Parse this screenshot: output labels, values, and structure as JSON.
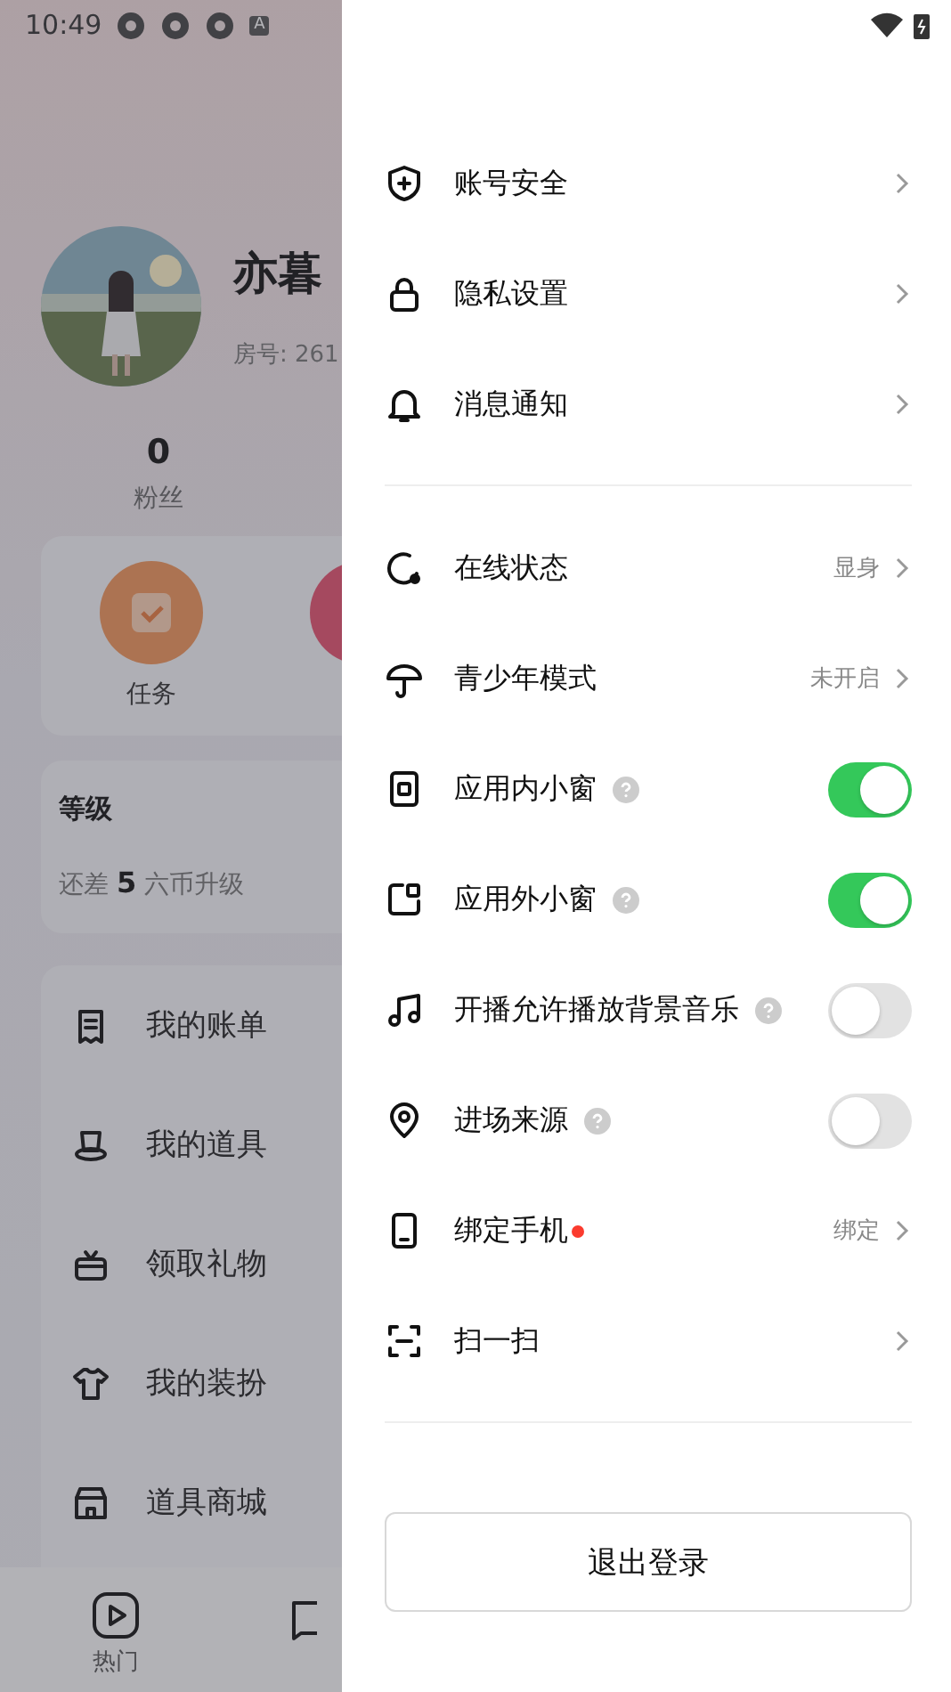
{
  "background_page": {
    "status_bar": {
      "time": "10:49",
      "badge": "A"
    },
    "profile": {
      "name": "亦暮",
      "room": "房号: 261"
    },
    "stats": [
      {
        "value": "0",
        "label": "粉丝"
      }
    ],
    "shortcuts": [
      {
        "label": "任务"
      }
    ],
    "level_card": {
      "title": "等级",
      "hint": "还差 **5** 六币升级"
    },
    "menu": [
      {
        "label": "我的账单"
      },
      {
        "label": "我的道具"
      },
      {
        "label": "领取礼物"
      },
      {
        "label": "我的装扮"
      },
      {
        "label": "道具商城"
      }
    ],
    "bottom_nav": [
      {
        "label": "热门",
        "selected": false
      }
    ]
  },
  "drawer": {
    "groups": [
      {
        "items": [
          {
            "kind": "link",
            "label": "账号安全"
          },
          {
            "kind": "link",
            "label": "隐私设置"
          },
          {
            "kind": "link",
            "label": "消息通知"
          }
        ]
      },
      {
        "items": [
          {
            "kind": "link",
            "label": "在线状态",
            "value": "显身"
          },
          {
            "kind": "link",
            "label": "青少年模式",
            "value": "未开启"
          },
          {
            "kind": "toggle",
            "label": "应用内小窗",
            "help": true,
            "on": true
          },
          {
            "kind": "toggle",
            "label": "应用外小窗",
            "help": true,
            "on": true
          },
          {
            "kind": "toggle",
            "label": "开播允许播放背景音乐",
            "help": true,
            "on": false
          },
          {
            "kind": "toggle",
            "label": "进场来源",
            "help": true,
            "on": false
          },
          {
            "kind": "link",
            "label": "绑定手机",
            "dot": true,
            "value": "绑定"
          },
          {
            "kind": "link",
            "label": "扫一扫"
          }
        ]
      }
    ],
    "logout_button": "退出登录"
  }
}
